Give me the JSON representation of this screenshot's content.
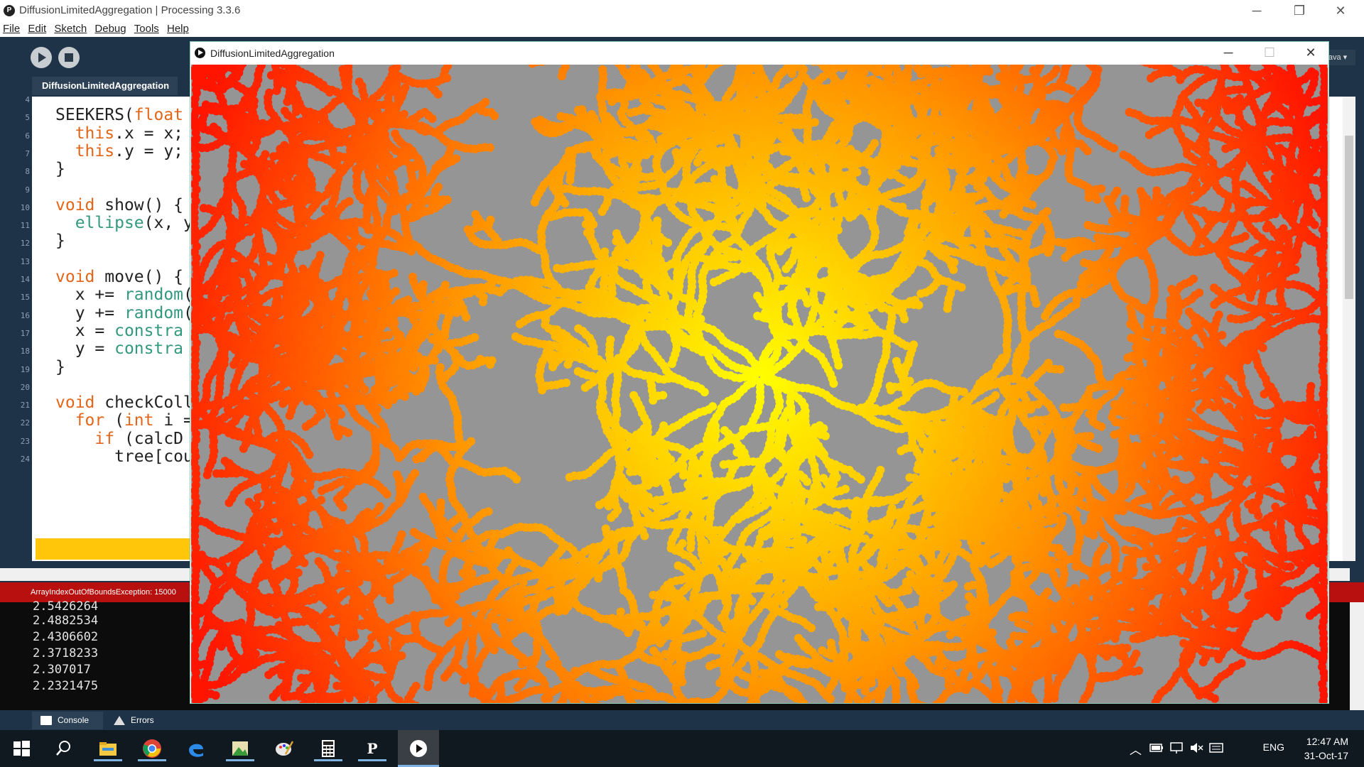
{
  "ide": {
    "title": "DiffusionLimitedAggregation | Processing 3.3.6",
    "app_icon": "processing-icon",
    "menu": [
      "File",
      "Edit",
      "Sketch",
      "Debug",
      "Tools",
      "Help"
    ],
    "window_buttons": {
      "minimize": "─",
      "restore": "❐",
      "close": "✕"
    },
    "mode_label": "ava ▾",
    "tab_label": "DiffusionLimitedAggregation",
    "error_text": "ArrayIndexOutOfBoundsException: 15000"
  },
  "editor": {
    "highlight_color": "#ffc60a",
    "lines": [
      {
        "num": "4",
        "text": ""
      },
      {
        "num": "5",
        "text": "SEEKERS(float"
      },
      {
        "num": "6",
        "text": "  this.x = x;"
      },
      {
        "num": "7",
        "text": "  this.y = y;"
      },
      {
        "num": "8",
        "text": "}"
      },
      {
        "num": "9",
        "text": ""
      },
      {
        "num": "10",
        "text": "void show() {"
      },
      {
        "num": "11",
        "text": "  ellipse(x, y"
      },
      {
        "num": "12",
        "text": "}"
      },
      {
        "num": "13",
        "text": ""
      },
      {
        "num": "14",
        "text": "void move() {"
      },
      {
        "num": "15",
        "text": "  x += random("
      },
      {
        "num": "16",
        "text": "  y += random("
      },
      {
        "num": "17",
        "text": "  x = constra"
      },
      {
        "num": "18",
        "text": "  y = constra"
      },
      {
        "num": "19",
        "text": "}"
      },
      {
        "num": "20",
        "text": ""
      },
      {
        "num": "21",
        "text": "void checkColl"
      },
      {
        "num": "22",
        "text": "  for (int i ="
      },
      {
        "num": "23",
        "text": "    if (calcD"
      },
      {
        "num": "24",
        "text": "      tree[cou"
      }
    ]
  },
  "console": {
    "lines": [
      "2.5426264",
      "2.4882534",
      "2.4306602",
      "2.3718233",
      "2.307017",
      "2.2321475"
    ],
    "tabs": [
      "Console",
      "Errors"
    ]
  },
  "sketch": {
    "title": "DiffusionLimitedAggregation",
    "window_buttons": {
      "minimize": "─",
      "maximize": "☐",
      "close": "✕"
    },
    "background": "#959595",
    "colors": {
      "center": "#ffff00",
      "mid": "#ff9900",
      "edge": "#ff1a00"
    }
  },
  "taskbar": {
    "apps": [
      "windows-start-icon",
      "search-icon",
      "file-explorer-icon",
      "chrome-icon",
      "edge-icon",
      "photos-icon",
      "paint-icon",
      "calculator-icon",
      "processing-icon",
      "sketch-run-icon"
    ],
    "language": "ENG",
    "time": "12:47 AM",
    "date": "31-Oct-17"
  }
}
